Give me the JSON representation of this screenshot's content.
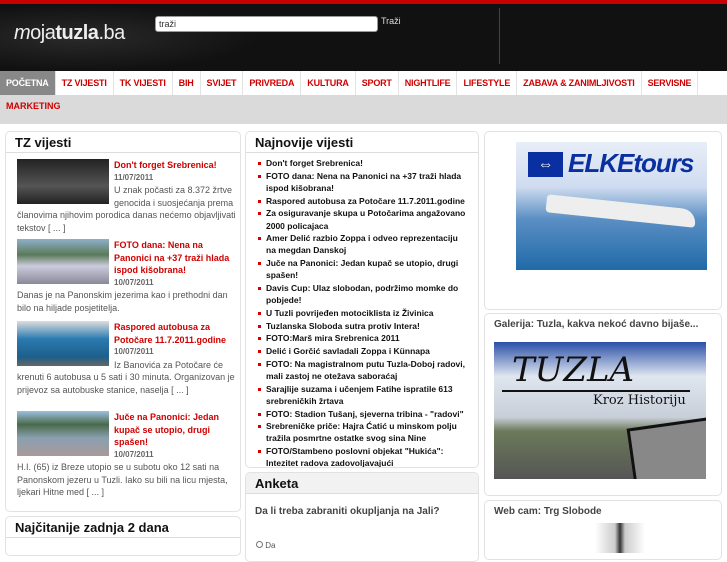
{
  "header": {
    "logo": "mojatuzla.ba",
    "search_value": "traži",
    "search_button": "Traži"
  },
  "nav": [
    "POČETNA",
    "TZ VIJESTI",
    "TK VIJESTI",
    "BIH",
    "SVIJET",
    "PRIVREDA",
    "KULTURA",
    "SPORT",
    "NIGHTLIFE",
    "LIFESTYLE",
    "ZABAVA & ZANIMLJIVOSTI",
    "SERVISNE"
  ],
  "subnav": [
    "MARKETING"
  ],
  "tz": {
    "title": "TZ vijesti",
    "items": [
      {
        "title": "Don't forget Srebrenica!",
        "date": "11/07/2011",
        "text": "U znak počasti za 8.372 žrtve genocida i suosjećanja prema članovima njihovim porodica danas nećemo objavljivati tekstov [ ... ]"
      },
      {
        "title": "FOTO dana: Nena na Panonici na +37 traži hlada ispod kišobrana!",
        "date": "10/07/2011",
        "text": "Danas je na Panonskim jezerima kao i prethodni dan bilo na hiljade posjetitelja."
      },
      {
        "title": "Raspored autobusa za Potočare 11.7.2011.godine",
        "date": "10/07/2011",
        "text": "Iz Banovića za Potočare će krenuti 6 autobusa u 5 sati i 30 minuta. Organizovan je prijevoz sa autobuske stanice, naselja  [ ... ]"
      },
      {
        "title": "Juče na Panonici: Jedan kupač se utopio, drugi spašen!",
        "date": "10/07/2011",
        "text": "H.I. (65) iz Breze utopio se u subotu oko 12 sati na Panonskom jezeru u Tuzli. Iako su bili na licu mjesta, ljekari Hitne med [ ... ]"
      }
    ]
  },
  "najcitanije": {
    "title": "Najčitanije zadnja 2 dana"
  },
  "najnovije": {
    "title": "Najnovije vijesti",
    "items": [
      "Don't forget Srebrenica!",
      "FOTO dana: Nena na Panonici na +37 traži hlada ispod kišobrana!",
      "Raspored autobusa za Potočare 11.7.2011.godine",
      "Za osiguravanje skupa u Potočarima angažovano 2000 policajaca",
      "Amer Delić razbio Zoppa i odveo reprezentaciju na megdan Danskoj",
      "Juče na Panonici: Jedan kupač se utopio, drugi spašen!",
      "Davis Cup: Ulaz slobodan, podržimo momke do pobjede!",
      "U Tuzli povrijeđen motociklista iz Živinica",
      "Tuzlanska Sloboda sutra protiv Intera!",
      "FOTO:Marš mira Srebrenica 2011",
      "Delić i Gorčić savladali Zoppa i Künnapa",
      "FOTO: Na magistralnom putu Tuzla-Doboj radovi, mali zastoj ne otežava saboraćaj",
      "Sarajlije suzama i učenjem Fatihe ispratile 613 srebreničkih žrtava",
      "FOTO: Stadion Tušanj, sjeverna tribina - \"radovi\"",
      "Srebreničke priče: Hajra Ćatić u minskom polju tražila posmrtne ostatke svog sina Nine",
      "FOTO/Stambeno poslovni objekat \"Hukića\": Intezitet radova zadovoljavajući"
    ]
  },
  "anketa": {
    "title": "Anketa",
    "question": "Da li treba zabraniti okupljanja na Jali?",
    "option1": "Da"
  },
  "right": {
    "ad_text": "ELKEtours",
    "galerija_title": "Galerija: Tuzla, kakva nekoć davno bijaše...",
    "galerija_img_title": "TUZLA",
    "galerija_img_sub": "Kroz Historiju",
    "webcam_title": "Web cam: Trg Slobode"
  }
}
